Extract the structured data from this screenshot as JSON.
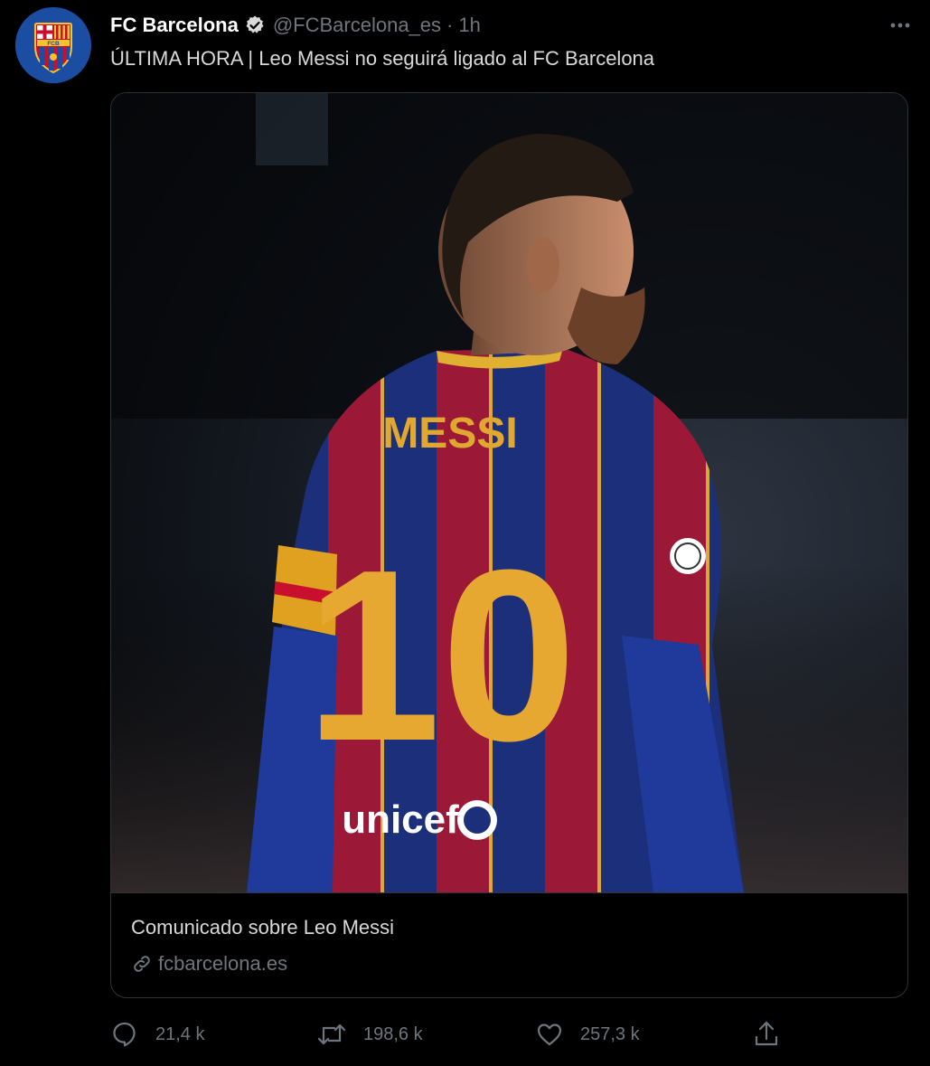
{
  "tweet": {
    "author_name": "FC Barcelona",
    "handle": "@FCBarcelona_es",
    "separator": "·",
    "time": "1h",
    "text": "ÚLTIMA HORA | Leo Messi no seguirá ligado al FC Barcelona",
    "verified_icon": "verified-badge-icon",
    "avatar_logo_text": "FCB"
  },
  "card": {
    "image_jersey_name": "MESSI",
    "image_jersey_number": "10",
    "image_sponsor": "unicef",
    "title": "Comunicado sobre Leo Messi",
    "domain": "fcbarcelona.es"
  },
  "actions": {
    "replies": "21,4 k",
    "retweets": "198,6 k",
    "likes": "257,3 k"
  },
  "icons": [
    "verified-badge-icon",
    "more-icon",
    "link-icon",
    "reply-icon",
    "retweet-icon",
    "like-icon",
    "share-icon"
  ],
  "colors": {
    "background": "#000000",
    "text": "#d9d9d9",
    "muted": "#6e767d",
    "border": "#2f3336"
  }
}
